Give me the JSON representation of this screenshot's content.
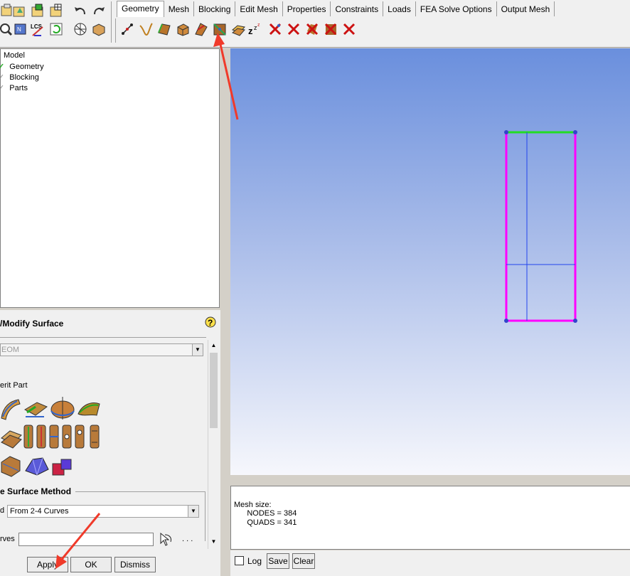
{
  "tabs": [
    "Geometry",
    "Mesh",
    "Blocking",
    "Edit Mesh",
    "Properties",
    "Constraints",
    "Loads",
    "FEA Solve Options",
    "Output Mesh"
  ],
  "tree": {
    "root": "Model",
    "items": [
      "Geometry",
      "Blocking",
      "Parts"
    ]
  },
  "panel": {
    "title": "/Modify Surface",
    "part_value": "EOM",
    "inherit_label": "erit Part",
    "method_header": "e Surface Method",
    "method_label": "d",
    "method_value": "From 2-4 Curves",
    "curves_label": "rves",
    "dots": ". . ."
  },
  "buttons": {
    "apply": "Apply",
    "ok": "OK",
    "dismiss": "Dismiss"
  },
  "console": {
    "line1": "Mesh size:",
    "line2": "      NODES = 384",
    "line3": "      QUADS = 341"
  },
  "consolebar": {
    "log": "Log",
    "save": "Save",
    "clear": "Clear"
  },
  "colors": {
    "accent_magenta": "#ff00ff",
    "accent_green": "#22dd22",
    "arrow_red": "#f03a2a"
  }
}
